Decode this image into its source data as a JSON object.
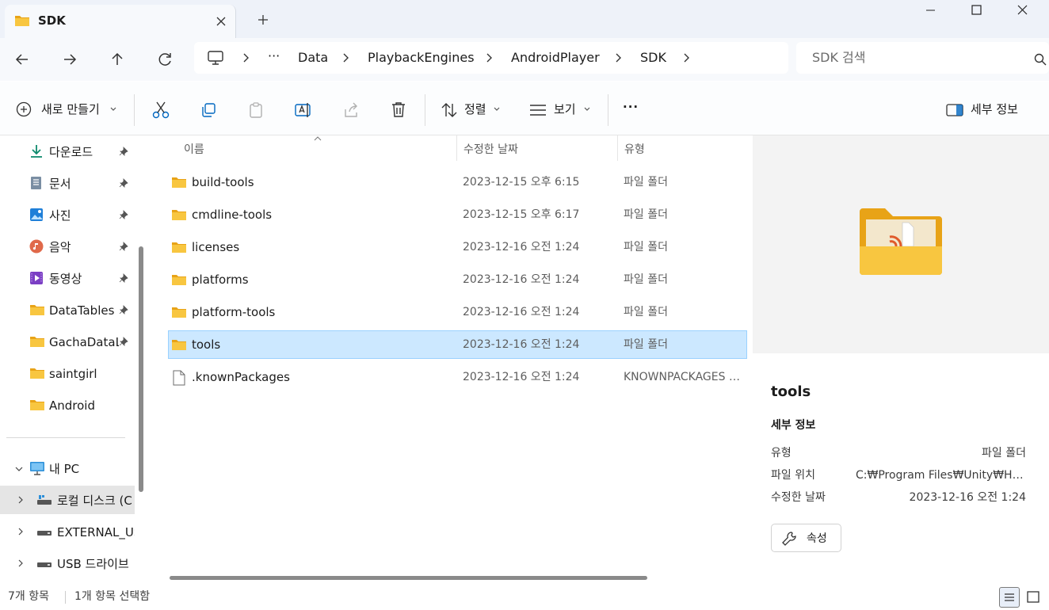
{
  "window": {
    "tab_title": "SDK"
  },
  "breadcrumb": {
    "more": "···",
    "items": [
      "Data",
      "PlaybackEngines",
      "AndroidPlayer",
      "SDK"
    ]
  },
  "search": {
    "placeholder": "SDK 검색"
  },
  "toolbar": {
    "new_label": "새로 만들기",
    "sort_label": "정렬",
    "view_label": "보기",
    "more_label": "···",
    "details_label": "세부 정보"
  },
  "sidebar": {
    "quick_access": [
      {
        "label": "다운로드",
        "icon": "download-icon"
      },
      {
        "label": "문서",
        "icon": "documents-icon"
      },
      {
        "label": "사진",
        "icon": "pictures-icon"
      },
      {
        "label": "음악",
        "icon": "music-icon"
      },
      {
        "label": "동영상",
        "icon": "videos-icon"
      },
      {
        "label": "DataTables",
        "icon": "folder-icon"
      },
      {
        "label": "GachaDataLi",
        "icon": "folder-icon"
      },
      {
        "label": "saintgirl",
        "icon": "folder-icon"
      },
      {
        "label": "Android",
        "icon": "folder-icon"
      }
    ],
    "pc_label": "내 PC",
    "drives": [
      {
        "label": "로컬 디스크 (C",
        "icon": "local-disk-icon"
      },
      {
        "label": "EXTERNAL_US",
        "icon": "external-drive-icon"
      },
      {
        "label": "USB 드라이브",
        "icon": "usb-drive-icon"
      }
    ]
  },
  "columns": {
    "name": "이름",
    "date": "수정한 날짜",
    "type": "유형"
  },
  "files": [
    {
      "name": "build-tools",
      "date": "2023-12-15 오후 6:15",
      "type": "파일 폴더",
      "icon": "folder-icon"
    },
    {
      "name": "cmdline-tools",
      "date": "2023-12-15 오후 6:17",
      "type": "파일 폴더",
      "icon": "folder-icon"
    },
    {
      "name": "licenses",
      "date": "2023-12-16 오전 1:24",
      "type": "파일 폴더",
      "icon": "folder-icon"
    },
    {
      "name": "platforms",
      "date": "2023-12-16 오전 1:24",
      "type": "파일 폴더",
      "icon": "folder-icon"
    },
    {
      "name": "platform-tools",
      "date": "2023-12-16 오전 1:24",
      "type": "파일 폴더",
      "icon": "folder-icon"
    },
    {
      "name": "tools",
      "date": "2023-12-16 오전 1:24",
      "type": "파일 폴더",
      "icon": "folder-icon",
      "selected": true
    },
    {
      "name": ".knownPackages",
      "date": "2023-12-16 오전 1:24",
      "type": "KNOWNPACKAGES 파일",
      "icon": "file-icon"
    }
  ],
  "details": {
    "title": "tools",
    "section": "세부 정보",
    "props": [
      {
        "label": "유형",
        "value": "파일 폴더"
      },
      {
        "label": "파일 위치",
        "value": "C:₩Program Files₩Unity₩Hub₩Editor"
      },
      {
        "label": "수정한 날짜",
        "value": "2023-12-16 오전 1:24"
      }
    ],
    "prop_button": "속성"
  },
  "status": {
    "count": "7개 항목",
    "selected": "1개 항목 선택함"
  },
  "colors": {
    "accent": "#0067c0",
    "selection": "#cce8ff",
    "folder": "#f8c640"
  }
}
